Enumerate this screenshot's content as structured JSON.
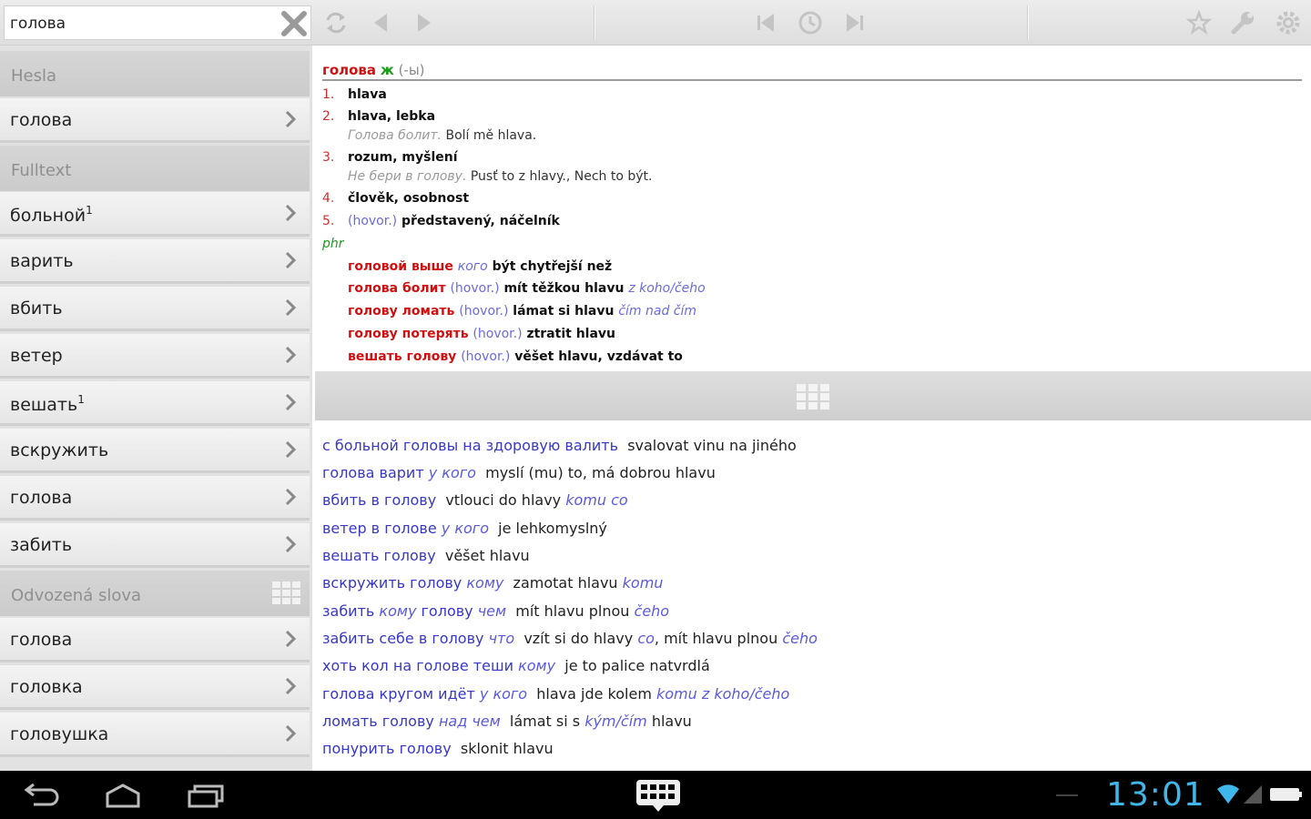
{
  "search": {
    "value": "голова"
  },
  "left": {
    "sections": [
      {
        "title": "Hesla"
      },
      {
        "title": "Fulltext"
      },
      {
        "title": "Odvozená slova"
      }
    ],
    "hesla_items": [
      {
        "label": "голова"
      }
    ],
    "fulltext_items": [
      {
        "label": "больной",
        "sup": "1"
      },
      {
        "label": "варить",
        "sup": ""
      },
      {
        "label": "вбить",
        "sup": ""
      },
      {
        "label": "ветер",
        "sup": ""
      },
      {
        "label": "вешать",
        "sup": "1"
      },
      {
        "label": "вскружить",
        "sup": ""
      },
      {
        "label": "голова",
        "sup": ""
      },
      {
        "label": "забить",
        "sup": ""
      }
    ],
    "derived_items": [
      {
        "label": "голова"
      },
      {
        "label": "головка"
      },
      {
        "label": "головушка"
      }
    ]
  },
  "definition": {
    "headword": "голова",
    "gender": "ж",
    "ending": "(-ы)",
    "senses": [
      {
        "num": "1.",
        "text": "hlava"
      },
      {
        "num": "2.",
        "text": "hlava, lebka",
        "ex_ru": "Голова болит.",
        "ex_cz": "Bolí mě hlava."
      },
      {
        "num": "3.",
        "text": "rozum, myšlení",
        "ex_ru": "Не бери в голову.",
        "ex_cz": "Pusť to z hlavy., Nech to být."
      },
      {
        "num": "4.",
        "text": "člověk, osobnost"
      },
      {
        "num": "5.",
        "note": "(hovor.)",
        "text": "představený, náčelník"
      }
    ],
    "phr_label": "phr",
    "phrases": [
      {
        "ru": "головой выше",
        "note": "кого",
        "cz": "být chytřejší než",
        "tail": ""
      },
      {
        "ru": "голова болит",
        "note": "(hovor.)",
        "cz": "mít těžkou hlavu",
        "tail": "z koho/čeho"
      },
      {
        "ru": "голову ломать",
        "note": "(hovor.)",
        "cz": "lámat si hlavu",
        "tail": "čím nad čím"
      },
      {
        "ru": "голову потерять",
        "note": "(hovor.)",
        "cz": "ztratit hlavu",
        "tail": ""
      },
      {
        "ru": "вешать голову",
        "note": "(hovor.)",
        "cz": "věšet hlavu, vzdávat to",
        "tail": ""
      }
    ]
  },
  "fulltext": [
    {
      "ru": "с больной головы на здоровую валить",
      "cz": "svalovat vinu na jiného"
    },
    {
      "ru": "голова варит",
      "ru_it": "у кого",
      "cz": "myslí (mu) to, má dobrou hlavu"
    },
    {
      "ru": "вбить в голову",
      "cz": "vtlouci do hlavy",
      "cz_it": "komu co"
    },
    {
      "ru": "ветер в голове",
      "ru_it": "у кого",
      "cz": "je lehkomyslný"
    },
    {
      "ru": "вешать голову",
      "cz": "věšet hlavu"
    },
    {
      "ru": "вскружить голову",
      "ru_it": "кому",
      "cz": "zamotat hlavu",
      "cz_it": "komu"
    },
    {
      "ru": "забить",
      "ru_it": "кому",
      "ru2": "голову",
      "ru_it2": "чем",
      "cz": "mít hlavu plnou",
      "cz_it": "čeho"
    },
    {
      "ru": "забить себе в голову",
      "ru_it": "что",
      "cz": "vzít si do hlavy",
      "cz_it": "co",
      "cz2": ", mít hlavu plnou",
      "cz_it2": "čeho"
    },
    {
      "ru": "хоть кол на голове теши",
      "ru_it": "кому",
      "cz": "je to palice natvrdlá"
    },
    {
      "ru": "голова кругом идёт",
      "ru_it": "у кого",
      "cz": "hlava jde kolem",
      "cz_it": "komu z koho/čeho"
    },
    {
      "ru": "ломать голову",
      "ru_it": "над чем",
      "cz": "lámat si s",
      "cz_it": "kým/čím",
      "cz2": " hlavu"
    },
    {
      "ru": "понурить голову",
      "cz": "sklonit hlavu"
    }
  ],
  "status": {
    "clock": "13:01"
  },
  "icons": [
    "clear-x-icon",
    "swap-icon",
    "back-arrow-icon",
    "forward-arrow-icon",
    "history-back-icon",
    "history-icon",
    "history-forward-icon",
    "star-icon",
    "wrench-icon",
    "gear-icon",
    "chevron-right-icon",
    "grid-icon",
    "nav-back-icon",
    "nav-home-icon",
    "nav-recents-icon",
    "keyboard-icon",
    "wifi-icon",
    "battery-icon"
  ]
}
